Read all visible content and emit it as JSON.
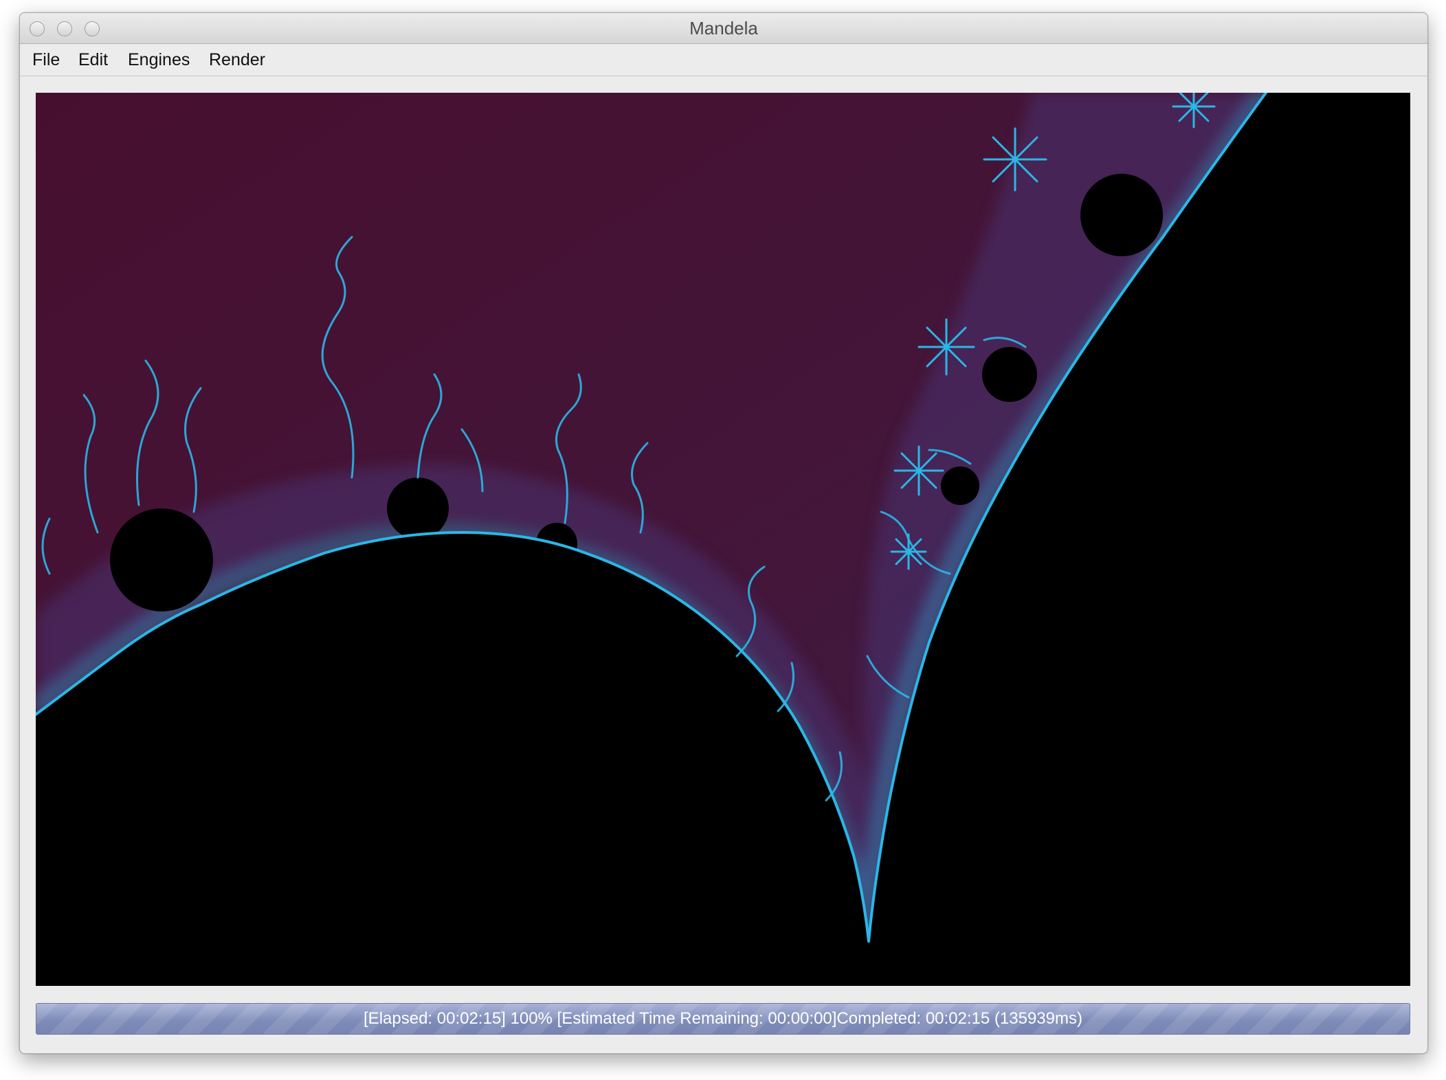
{
  "window": {
    "title": "Mandela"
  },
  "menu": {
    "items": [
      {
        "label": "File"
      },
      {
        "label": "Edit"
      },
      {
        "label": "Engines"
      },
      {
        "label": "Render"
      }
    ]
  },
  "render": {
    "image": "mandelbrot-fractal-zoom",
    "colors": {
      "background": "#000000",
      "exterior": "#46122f",
      "edge_glow": "#3f2c63",
      "filament": "#2bb7e6"
    }
  },
  "status": {
    "text": "[Elapsed: 00:02:15] 100% [Estimated Time Remaining: 00:00:00]Completed: 00:02:15 (135939ms)",
    "progress_fraction": 1.0
  }
}
